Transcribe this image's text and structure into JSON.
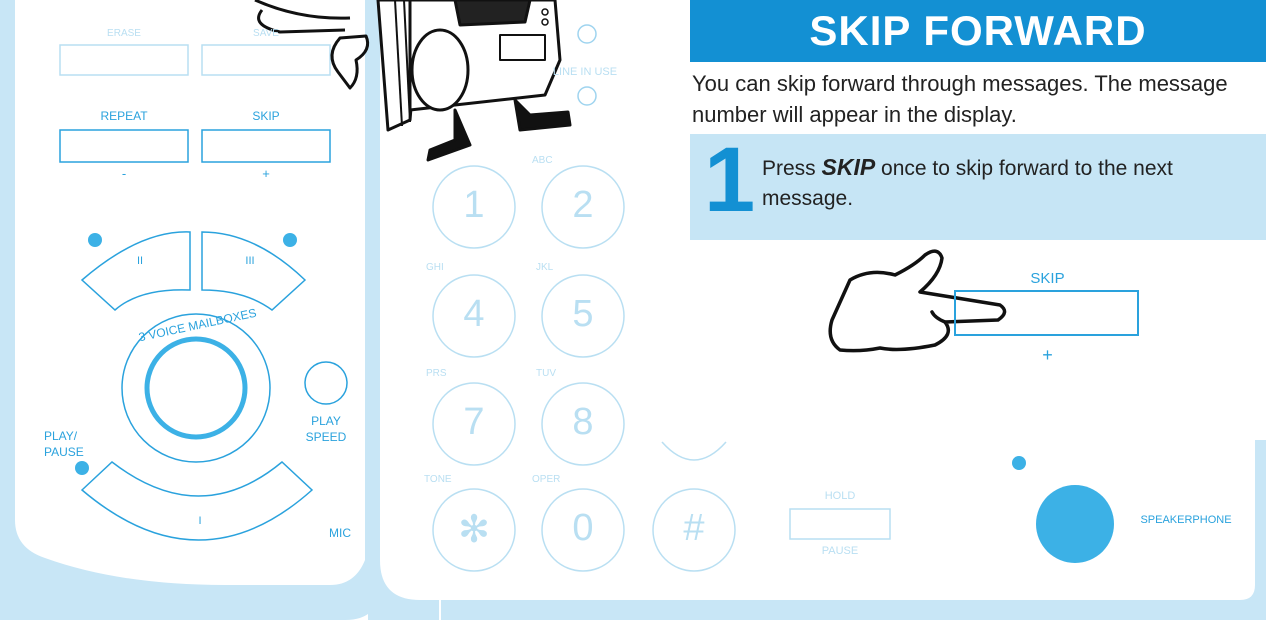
{
  "title": "SKIP FORWARD",
  "intro": "You can skip forward through messages. The message number will appear in the display.",
  "step": {
    "number": "1",
    "text_before": "Press ",
    "keyword": "SKIP",
    "text_after": " once to skip forward to the next message."
  },
  "callout": {
    "label": "SKIP",
    "sub": "+"
  },
  "phone": {
    "erase": "ERASE",
    "save": "SAVE",
    "repeat": "REPEAT",
    "skip": "SKIP",
    "minus": "-",
    "plus": "+",
    "mailbox_2": "II",
    "mailbox_3": "III",
    "mailbox_1": "I",
    "mailboxes": "3 VOICE MAILBOXES",
    "play_pause": "PLAY/ PAUSE",
    "play_speed": "PLAY SPEED",
    "mic": "MIC",
    "line_in_use": "LINE IN USE",
    "hold": "HOLD",
    "pause": "PAUSE",
    "speakerphone": "SPEAKERPHONE",
    "keys": [
      {
        "digit": "1",
        "letters": ""
      },
      {
        "digit": "2",
        "letters": "ABC"
      },
      {
        "digit": "4",
        "letters": "GHI"
      },
      {
        "digit": "5",
        "letters": "JKL"
      },
      {
        "digit": "7",
        "letters": "PRS"
      },
      {
        "digit": "8",
        "letters": "TUV"
      },
      {
        "digit": "✻",
        "letters": "TONE"
      },
      {
        "digit": "0",
        "letters": "OPER"
      },
      {
        "digit": "#",
        "letters": ""
      }
    ]
  },
  "colors": {
    "accent": "#1390d3",
    "light_accent": "#c6e5f5",
    "outline": "#9fd4ef",
    "phone_fill": "#c8e6f6"
  }
}
